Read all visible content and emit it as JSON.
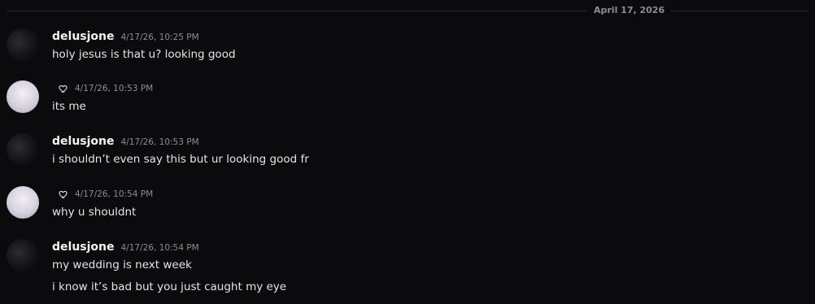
{
  "date_divider": "April 17, 2026",
  "messages": [
    {
      "author": "delusjone",
      "timestamp": "4/17/26, 10:25 PM",
      "lines": [
        "holy jesus is that u? looking good"
      ]
    },
    {
      "author": "",
      "timestamp": "4/17/26, 10:53 PM",
      "lines": [
        "its me"
      ]
    },
    {
      "author": "delusjone",
      "timestamp": "4/17/26, 10:53 PM",
      "lines": [
        "i shouldn’t even say this but ur looking good fr"
      ]
    },
    {
      "author": "",
      "timestamp": "4/17/26, 10:54 PM",
      "lines": [
        "why u shouldnt"
      ]
    },
    {
      "author": "delusjone",
      "timestamp": "4/17/26, 10:54 PM",
      "lines": [
        "my wedding is next week",
        "i know it’s bad but you just caught my eye"
      ]
    }
  ],
  "icons": {
    "heart": "heart-icon"
  },
  "colors": {
    "background": "#0b0b0e",
    "text": "#e3e5e8",
    "muted": "#8a8d95"
  }
}
